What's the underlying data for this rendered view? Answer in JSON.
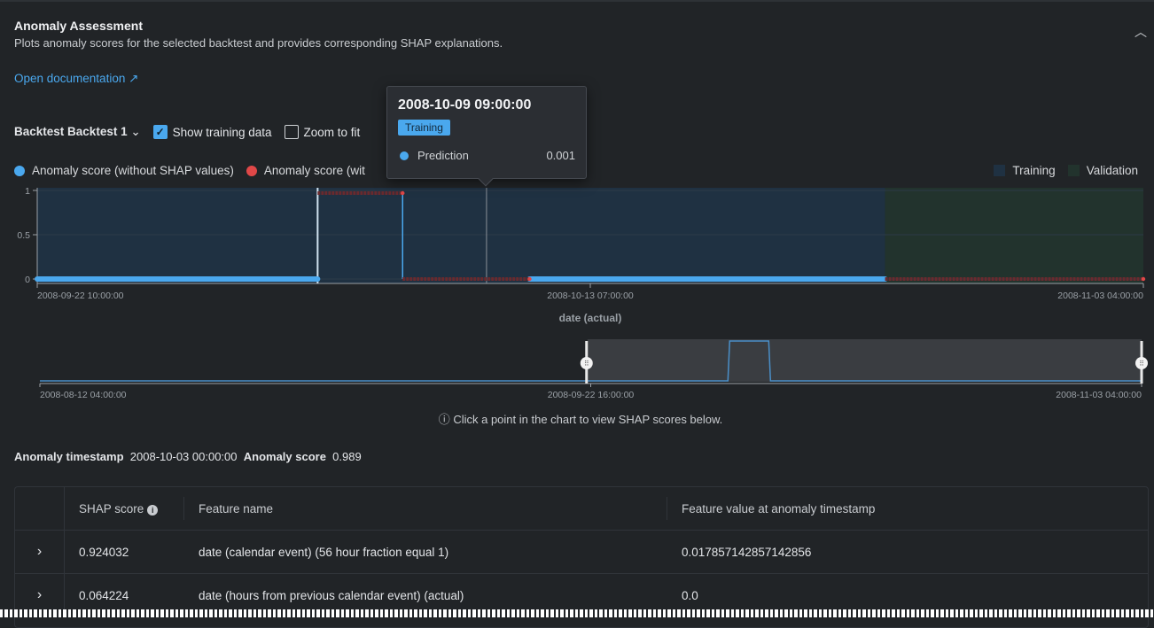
{
  "header": {
    "title": "Anomaly Assessment",
    "subtitle": "Plots anomaly scores for the selected backtest and provides corresponding SHAP explanations.",
    "doc_link": "Open documentation"
  },
  "controls": {
    "backtest_label": "Backtest",
    "backtest_value": "Backtest 1",
    "show_training": "Show training data",
    "show_training_checked": true,
    "zoom_to_fit": "Zoom to fit",
    "zoom_to_fit_checked": false
  },
  "legend": {
    "series_a": "Anomaly score (without SHAP values)",
    "series_b": "Anomaly score (wit",
    "training": "Training",
    "validation": "Validation"
  },
  "colors": {
    "accent": "#4aa8ee",
    "red": "#e04848",
    "training": "#1f3142",
    "validation": "#22332d"
  },
  "tooltip": {
    "title": "2008-10-09 09:00:00",
    "badge": "Training",
    "label": "Prediction",
    "value": "0.001"
  },
  "chart_data": {
    "type": "line",
    "xlabel": "date (actual)",
    "ylim": [
      0,
      1
    ],
    "yticks": [
      "0",
      "0.5",
      "1"
    ],
    "xticks": [
      "2008-09-22 10:00:00",
      "2008-10-13 07:00:00",
      "2008-11-03 04:00:00"
    ],
    "xrange": [
      "2008-09-22 10:00:00",
      "2008-11-03 04:00:00"
    ],
    "regions": [
      {
        "name": "Training",
        "from": "2008-09-22 10:00:00",
        "to": "2008-10-24 10:00:00"
      },
      {
        "name": "Validation",
        "from": "2008-10-24 10:00:00",
        "to": "2008-11-03 04:00:00"
      }
    ],
    "series": [
      {
        "name": "Anomaly score (without SHAP values)",
        "color": "#4aa8ee",
        "segments": [
          {
            "from": "2008-09-22 10:00:00",
            "to": "2008-10-03 00:00:00",
            "y": 0
          },
          {
            "from": "2008-10-11 00:00:00",
            "to": "2008-10-24 10:00:00",
            "y": 0
          }
        ]
      },
      {
        "name": "Anomaly score (with SHAP values)",
        "color": "#e04848",
        "segments": [
          {
            "from": "2008-10-03 00:00:00",
            "to": "2008-10-06 05:00:00",
            "y": 0.97
          },
          {
            "from": "2008-10-06 05:00:00",
            "to": "2008-10-11 00:00:00",
            "y": 0
          },
          {
            "from": "2008-10-24 10:00:00",
            "to": "2008-11-03 04:00:00",
            "y": 0
          }
        ]
      }
    ],
    "hover": "2008-10-09 09:00:00",
    "selected": "2008-10-03 00:00:00",
    "navigator": {
      "xticks": [
        "2008-08-12 04:00:00",
        "2008-09-22 16:00:00",
        "2008-11-03 04:00:00"
      ],
      "range": [
        "2008-08-12 04:00:00",
        "2008-11-03 04:00:00"
      ],
      "selection": [
        "2008-09-22 10:00:00",
        "2008-11-03 04:00:00"
      ],
      "spike": [
        "2008-10-03 00:00:00",
        "2008-10-06 05:00:00"
      ]
    }
  },
  "hint": "Click a point in the chart to view SHAP scores below.",
  "summary": {
    "ts_label": "Anomaly timestamp",
    "ts_value": "2008-10-03 00:00:00",
    "score_label": "Anomaly score",
    "score_value": "0.989"
  },
  "table": {
    "headers": [
      "SHAP score",
      "Feature name",
      "Feature value at anomaly timestamp"
    ],
    "rows": [
      {
        "shap": "0.924032",
        "feature": "date (calendar event) (56 hour fraction equal 1)",
        "value": "0.017857142857142856"
      },
      {
        "shap": "0.064224",
        "feature": "date (hours from previous calendar event) (actual)",
        "value": "0.0"
      }
    ]
  }
}
